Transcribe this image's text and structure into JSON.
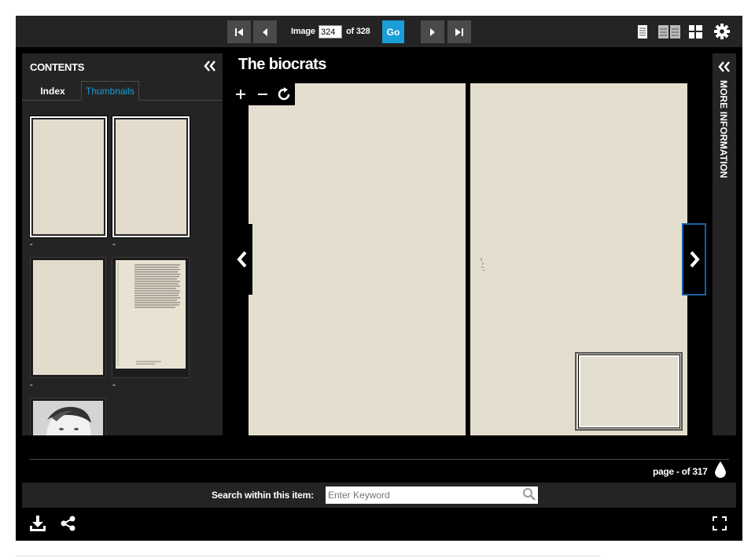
{
  "toolbar": {
    "image_label": "Image",
    "image_value": "324",
    "of_label": "of 328",
    "go_label": "Go"
  },
  "contents": {
    "title": "CONTENTS",
    "tabs": [
      {
        "label": "Index"
      },
      {
        "label": "Thumbnails"
      }
    ],
    "thumbnails": [
      {
        "caption": "-"
      },
      {
        "caption": "-"
      },
      {
        "caption": "-"
      },
      {
        "caption": "-"
      }
    ]
  },
  "book": {
    "title": "The biocrats"
  },
  "more_info": {
    "label": "MORE INFORMATION"
  },
  "pager": {
    "page_text": "page - of 317"
  },
  "search": {
    "label": "Search within this item:",
    "placeholder": "Enter Keyword",
    "value": ""
  },
  "colors": {
    "accent": "#1a9ed6",
    "panel": "#242424",
    "background": "#000000",
    "page": "#e4ded0"
  },
  "icons": [
    "first-page-icon",
    "previous-page-icon",
    "next-page-icon",
    "last-page-icon",
    "single-page-view-icon",
    "two-page-view-icon",
    "grid-view-icon",
    "settings-icon",
    "collapse-left-icon",
    "collapse-right-icon",
    "zoom-in-icon",
    "zoom-out-icon",
    "rotate-icon",
    "droplet-icon",
    "search-icon",
    "download-icon",
    "share-icon",
    "fullscreen-icon"
  ]
}
